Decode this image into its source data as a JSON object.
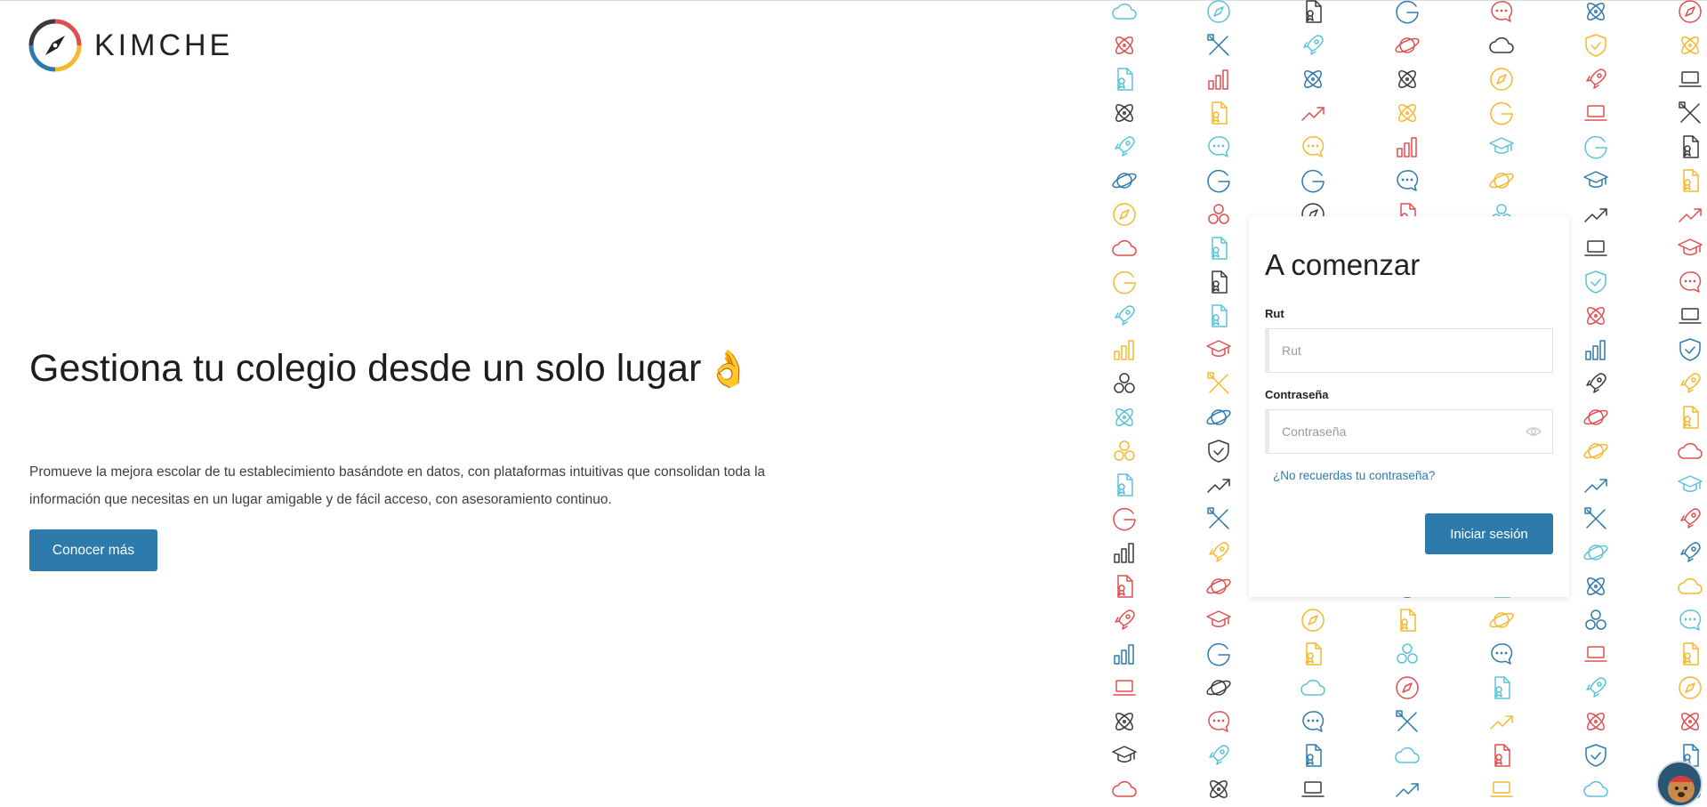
{
  "brand": {
    "name": "KIMCHE"
  },
  "hero": {
    "headline": "Gestiona tu colegio desde un solo lugar",
    "emoji": "👌",
    "description": "Promueve la mejora escolar de tu establecimiento basándote en datos, con plataformas intuitivas que consolidan toda la información que necesitas en un lugar amigable y de fácil acceso, con asesoramiento continuo.",
    "cta_label": "Conocer más"
  },
  "login": {
    "title": "A comenzar",
    "rut_label": "Rut",
    "rut_placeholder": "Rut",
    "password_label": "Contraseña",
    "password_placeholder": "Contraseña",
    "forgot_label": "¿No recuerdas tu contraseña?",
    "submit_label": "Iniciar sesión"
  },
  "colors": {
    "accent": "#2d7aad",
    "pattern": [
      "#f5b82e",
      "#e04f4f",
      "#5bc3d9",
      "#2d7aad",
      "#3a3a3a"
    ]
  },
  "pattern_icons": [
    "chat-icon",
    "atom-icon",
    "bar-chart-icon",
    "graduation-cap-icon",
    "planet-icon",
    "laptop-icon",
    "certificate-icon",
    "cloud-icon",
    "rocket-icon",
    "compass-icon",
    "letter-g-icon",
    "tools-icon",
    "shield-icon",
    "trend-up-icon",
    "circles-icon"
  ]
}
